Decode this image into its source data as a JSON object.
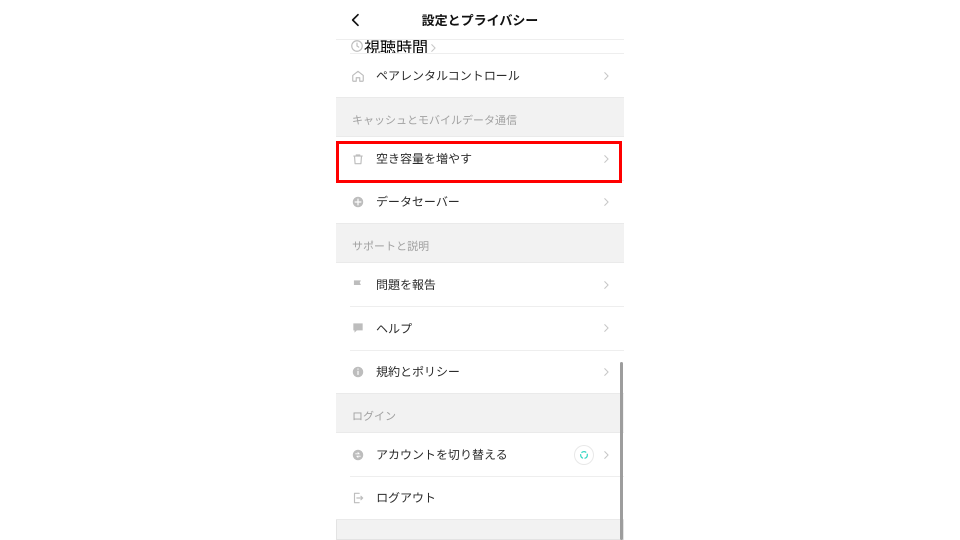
{
  "header": {
    "title": "設定とプライバシー"
  },
  "partial_row": {
    "label": "視聴時間"
  },
  "sections": [
    {
      "header": null,
      "rows": [
        {
          "icon": "home",
          "label": "ペアレンタルコントロール"
        }
      ]
    },
    {
      "header": "キャッシュとモバイルデータ通信",
      "rows": [
        {
          "icon": "trash",
          "label": "空き容量を増やす",
          "highlight": true
        },
        {
          "icon": "data-saver",
          "label": "データセーバー"
        }
      ]
    },
    {
      "header": "サポートと説明",
      "rows": [
        {
          "icon": "flag",
          "label": "問題を報告"
        },
        {
          "icon": "chat",
          "label": "ヘルプ"
        },
        {
          "icon": "info",
          "label": "規約とポリシー"
        }
      ]
    },
    {
      "header": "ログイン",
      "rows": [
        {
          "icon": "swap",
          "label": "アカウントを切り替える",
          "hasSpinner": true
        },
        {
          "icon": "logout",
          "label": "ログアウト",
          "noChevron": true
        }
      ]
    }
  ],
  "colors": {
    "highlight": "#ff0000",
    "row_bg": "#ffffff",
    "page_bg": "#f2f2f2",
    "icon": "#bdbdbd",
    "chevron": "#c7c7c7",
    "text": "#2b2b2b",
    "section_header": "#a1a1a1"
  }
}
